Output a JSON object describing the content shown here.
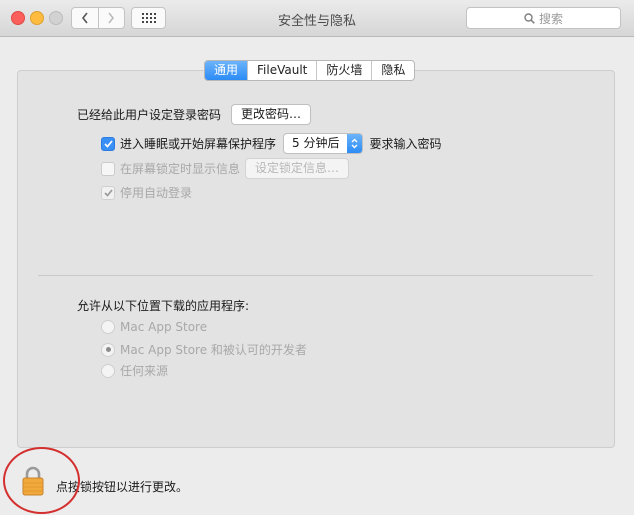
{
  "window": {
    "title": "安全性与隐私",
    "search_placeholder": "搜索"
  },
  "toolbar": {
    "back_icon": "chevron-left-icon",
    "forward_icon": "chevron-right-icon",
    "grid_icon": "grid-icon"
  },
  "tabs": [
    {
      "label": "通用",
      "active": true
    },
    {
      "label": "FileVault",
      "active": false
    },
    {
      "label": "防火墙",
      "active": false
    },
    {
      "label": "隐私",
      "active": false
    }
  ],
  "general": {
    "password_label": "已经给此用户设定登录密码",
    "change_password_button": "更改密码…",
    "require_password": {
      "checked": true,
      "prefix": "进入睡眠或开始屏幕保护程序",
      "delay_value": "5 分钟后",
      "suffix": "要求输入密码"
    },
    "show_message": {
      "checked": false,
      "label": "在屏幕锁定时显示信息",
      "button": "设定锁定信息…"
    },
    "disable_autologin": {
      "checked": true,
      "label": "停用自动登录"
    }
  },
  "downloads": {
    "label": "允许从以下位置下载的应用程序:",
    "options": [
      {
        "label": "Mac App Store",
        "selected": false
      },
      {
        "label": "Mac App Store 和被认可的开发者",
        "selected": true
      },
      {
        "label": "任何来源",
        "selected": false
      }
    ]
  },
  "footer": {
    "lock_icon": "lock-icon",
    "hint": "点按锁按钮以进行更改。"
  },
  "colors": {
    "accent": "#2c8cf5",
    "annotation": "#d42f2f"
  }
}
